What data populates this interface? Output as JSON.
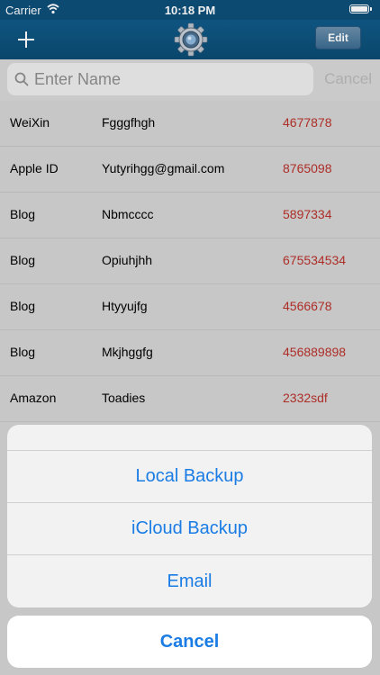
{
  "status_bar": {
    "carrier": "Carrier",
    "time": "10:18 PM"
  },
  "nav": {
    "edit_label": "Edit"
  },
  "search": {
    "placeholder": "Enter Name",
    "cancel_label": "Cancel"
  },
  "entries": [
    {
      "category": "WeiXin",
      "name": "Fgggfhgh",
      "password": "4677878"
    },
    {
      "category": "Apple ID",
      "name": "Yutyrihgg@gmail.com",
      "password": "8765098"
    },
    {
      "category": "Blog",
      "name": "Nbmcccc",
      "password": "5897334"
    },
    {
      "category": "Blog",
      "name": "Opiuhjhh",
      "password": "675534534"
    },
    {
      "category": "Blog",
      "name": "Htyyujfg",
      "password": "4566678"
    },
    {
      "category": "Blog",
      "name": "Mkjhggfg",
      "password": "456889898"
    },
    {
      "category": "Amazon",
      "name": "Toadies",
      "password": "2332sdf"
    }
  ],
  "action_sheet": {
    "options": [
      "Local Backup",
      "iCloud Backup",
      "Email"
    ],
    "cancel_label": "Cancel"
  },
  "colors": {
    "nav": "#0e4f7a",
    "password": "#b8302a",
    "action": "#1a7ce4"
  },
  "icons": [
    "wifi-icon",
    "battery-icon",
    "plus-icon",
    "gear-logo-icon",
    "search-icon"
  ]
}
